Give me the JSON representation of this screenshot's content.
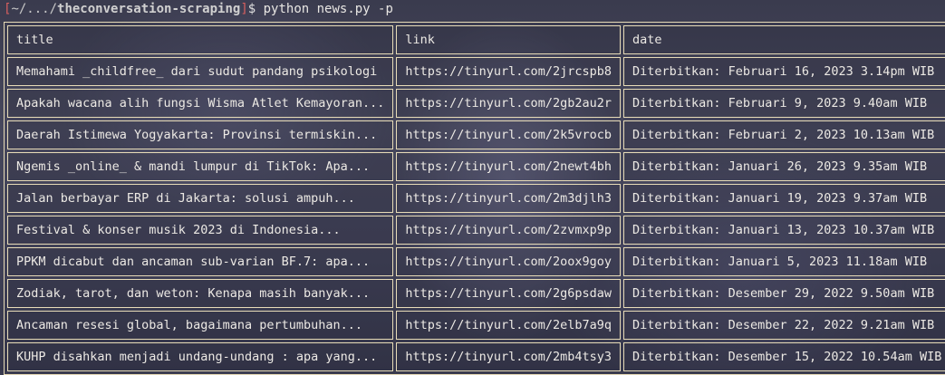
{
  "prompt": {
    "bracket_open": "[",
    "tilde": "~/.../",
    "dir": "theconversation-scraping",
    "bracket_close": "]",
    "dollar": "$ ",
    "command": "python news.py -p"
  },
  "table": {
    "headers": [
      "title",
      "link",
      "date"
    ],
    "rows": [
      {
        "title": "Memahami _childfree_ dari sudut pandang psikologi",
        "link": "https://tinyurl.com/2jrcspb8",
        "date": "Diterbitkan: Februari 16, 2023 3.14pm WIB"
      },
      {
        "title": "Apakah wacana alih fungsi Wisma Atlet Kemayoran...",
        "link": "https://tinyurl.com/2gb2au2r",
        "date": "Diterbitkan: Februari 9, 2023 9.40am WIB"
      },
      {
        "title": "Daerah Istimewa Yogyakarta: Provinsi termiskin...",
        "link": "https://tinyurl.com/2k5vrocb",
        "date": "Diterbitkan: Februari 2, 2023 10.13am WIB"
      },
      {
        "title": "Ngemis _online_ & mandi lumpur di TikTok: Apa...",
        "link": "https://tinyurl.com/2newt4bh",
        "date": "Diterbitkan: Januari 26, 2023 9.35am WIB"
      },
      {
        "title": "Jalan berbayar ERP di Jakarta: solusi ampuh...",
        "link": "https://tinyurl.com/2m3djlh3",
        "date": "Diterbitkan: Januari 19, 2023 9.37am WIB"
      },
      {
        "title": "Festival & konser musik 2023 di Indonesia...",
        "link": "https://tinyurl.com/2zvmxp9p",
        "date": "Diterbitkan: Januari 13, 2023 10.37am WIB"
      },
      {
        "title": "PPKM dicabut dan ancaman sub-varian BF.7: apa...",
        "link": "https://tinyurl.com/2oox9goy",
        "date": "Diterbitkan: Januari 5, 2023 11.18am WIB"
      },
      {
        "title": "Zodiak, tarot, dan weton: Kenapa masih banyak...",
        "link": "https://tinyurl.com/2g6psdaw",
        "date": "Diterbitkan: Desember 29, 2022 9.50am WIB"
      },
      {
        "title": "Ancaman resesi global, bagaimana pertumbuhan...",
        "link": "https://tinyurl.com/2elb7a9q",
        "date": "Diterbitkan: Desember 22, 2022 9.21am WIB"
      },
      {
        "title": "KUHP disahkan menjadi undang-undang : apa yang...",
        "link": "https://tinyurl.com/2mb4tsy3",
        "date": "Diterbitkan: Desember 15, 2022 10.54am WIB"
      }
    ]
  }
}
